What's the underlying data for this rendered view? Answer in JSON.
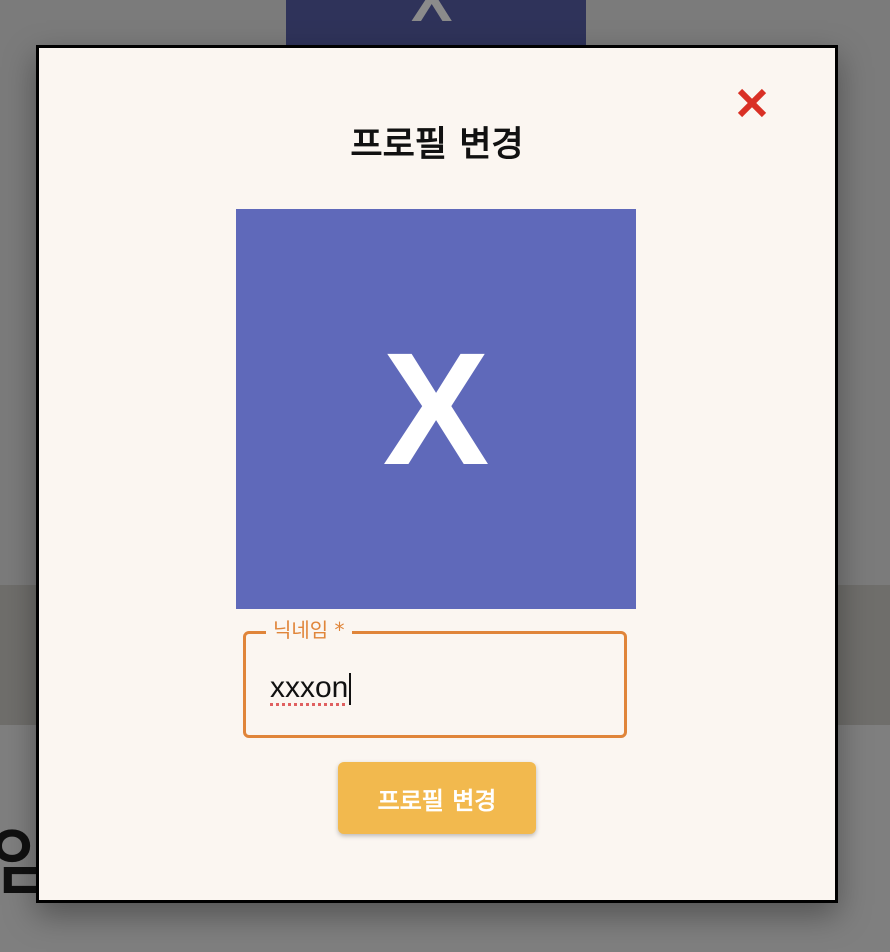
{
  "background": {
    "avatar_letter": "X",
    "heading_fragment": "임"
  },
  "modal": {
    "title": "프로필 변경",
    "close_icon": "close-x-icon",
    "avatar": {
      "letter": "X",
      "color": "#5f69ba"
    },
    "nickname_field": {
      "label": "닉네임 *",
      "value": "xxxon",
      "accent_color": "#e0853a"
    },
    "submit_label": "프로필 변경",
    "submit_color": "#f2b94e",
    "close_color": "#d93025"
  }
}
